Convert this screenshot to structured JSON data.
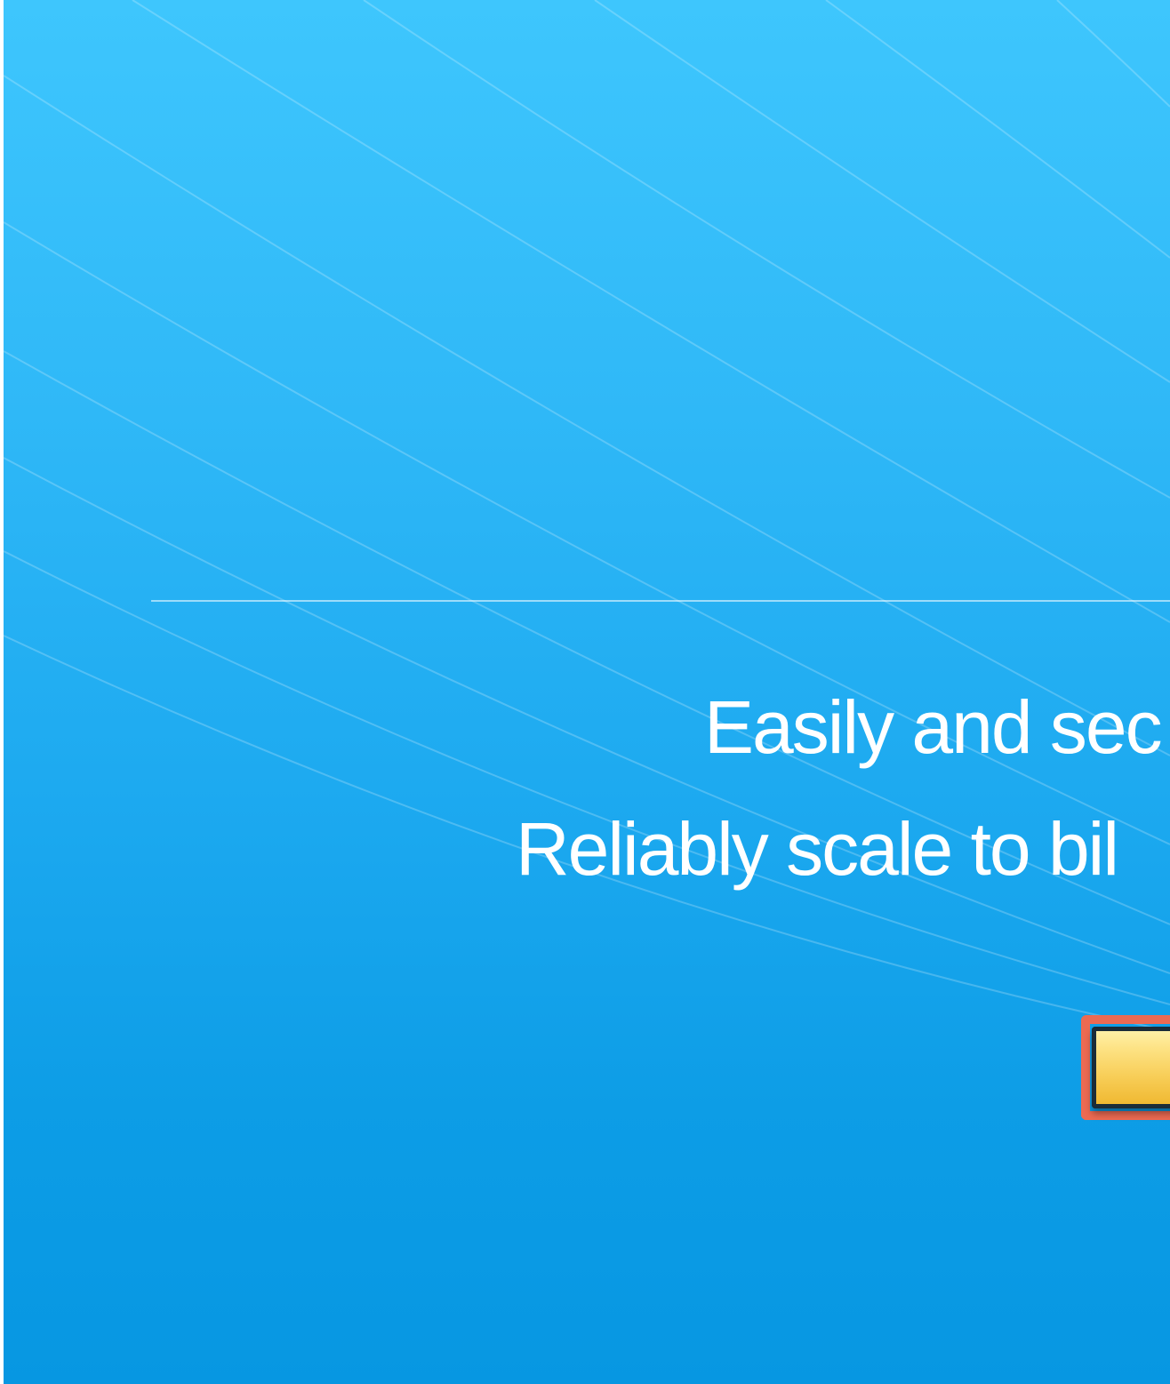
{
  "hero": {
    "tagline_line_1": "Easily and sec",
    "tagline_line_2": "Reliably scale to bil",
    "cta_label": ""
  },
  "colors": {
    "background_top": "#3ec6fd",
    "background_bottom": "#0797e2",
    "cta_fill": "#f8cf5a",
    "focus_outline": "#ec6a52"
  }
}
